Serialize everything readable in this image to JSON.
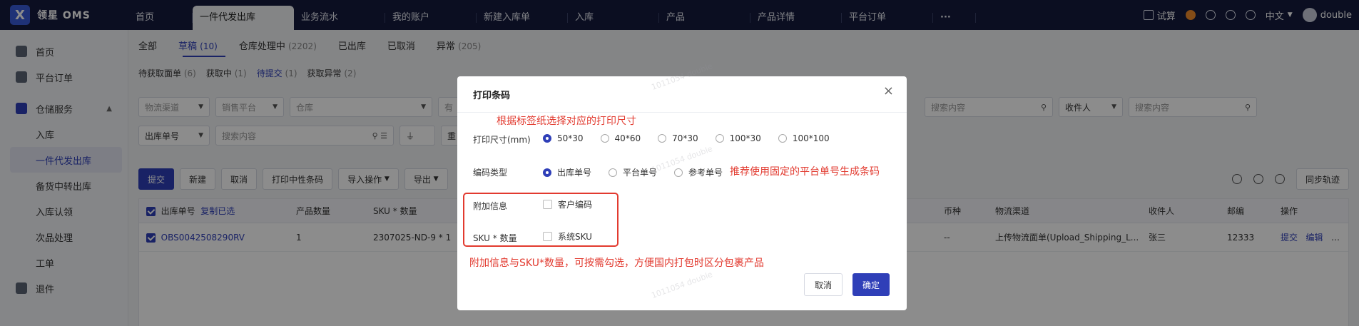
{
  "app": {
    "name": "领星 OMS",
    "logo_letter": "X"
  },
  "top_tabs": [
    "首页",
    "一件代发出库",
    "业务流水",
    "我的账户",
    "新建入库单",
    "入库",
    "产品",
    "产品详情",
    "平台订单",
    "···"
  ],
  "top_right": {
    "trial": "试算",
    "lang": "中文",
    "user": "double"
  },
  "sidebar": {
    "items": [
      {
        "label": "首页"
      },
      {
        "label": "平台订单"
      },
      {
        "label": "仓储服务"
      }
    ],
    "subs": [
      "入库",
      "一件代发出库",
      "备货中转出库",
      "入库认领",
      "次品处理",
      "工单"
    ],
    "return": "退件"
  },
  "status_tabs": [
    {
      "label": "全部",
      "count": ""
    },
    {
      "label": "草稿",
      "count": "(10)"
    },
    {
      "label": "仓库处理中",
      "count": "(2202)"
    },
    {
      "label": "已出库",
      "count": ""
    },
    {
      "label": "已取消",
      "count": ""
    },
    {
      "label": "异常",
      "count": "(205)"
    }
  ],
  "sub_tabs": [
    {
      "label": "待获取面单",
      "count": "(6)"
    },
    {
      "label": "获取中",
      "count": "(1)"
    },
    {
      "label": "待提交",
      "count": "(1)"
    },
    {
      "label": "获取异常",
      "count": "(2)"
    }
  ],
  "filters": {
    "logistics": "物流渠道",
    "platform": "销售平台",
    "warehouse": "仓库",
    "partial": "有",
    "search1": "搜索内容",
    "receiver": "收件人",
    "search2": "搜索内容",
    "order_no": "出库单号",
    "search3": "搜索内容",
    "reset": "重"
  },
  "toolbar": {
    "submit": "提交",
    "new": "新建",
    "cancel": "取消",
    "print_neutral": "打印中性条码",
    "import": "导入操作",
    "export": "导出",
    "sync": "同步轨迹"
  },
  "table": {
    "headers": {
      "order_no": "出库单号",
      "copy": "复制已选",
      "qty": "产品数量",
      "sku": "SKU * 数量",
      "currency": "币种",
      "channel": "物流渠道",
      "receiver": "收件人",
      "zip": "邮编",
      "action": "操作"
    },
    "row": {
      "order_no": "OBS0042508290RV",
      "qty": "1",
      "sku": "2307025-ND-9 * 1",
      "currency": "--",
      "channel": "上传物流面单(Upload_Shipping_L...",
      "receiver": "张三",
      "zip": "12333",
      "submit": "提交",
      "edit": "编辑",
      "more": "更多"
    }
  },
  "dialog": {
    "title": "打印条码",
    "size_label": "打印尺寸(mm)",
    "sizes": [
      "50*30",
      "40*60",
      "70*30",
      "100*30",
      "100*100"
    ],
    "code_label": "编码类型",
    "code_types": [
      "出库单号",
      "平台单号",
      "参考单号"
    ],
    "extra_label": "附加信息",
    "extra_option": "客户编码",
    "sku_label": "SKU * 数量",
    "sku_option": "系统SKU",
    "cancel": "取消",
    "ok": "确定"
  },
  "notes": {
    "size_tip": "根据标签纸选择对应的打印尺寸",
    "code_tip": "推荐使用固定的平台单号生成条码",
    "extra_tip": "附加信息与SKU*数量，可按需勾选，方便国内打包时区分包裹产品"
  },
  "colors": {
    "primary": "#2f3fb8",
    "topbar": "#141a3d",
    "annotation": "#e23a2f"
  }
}
